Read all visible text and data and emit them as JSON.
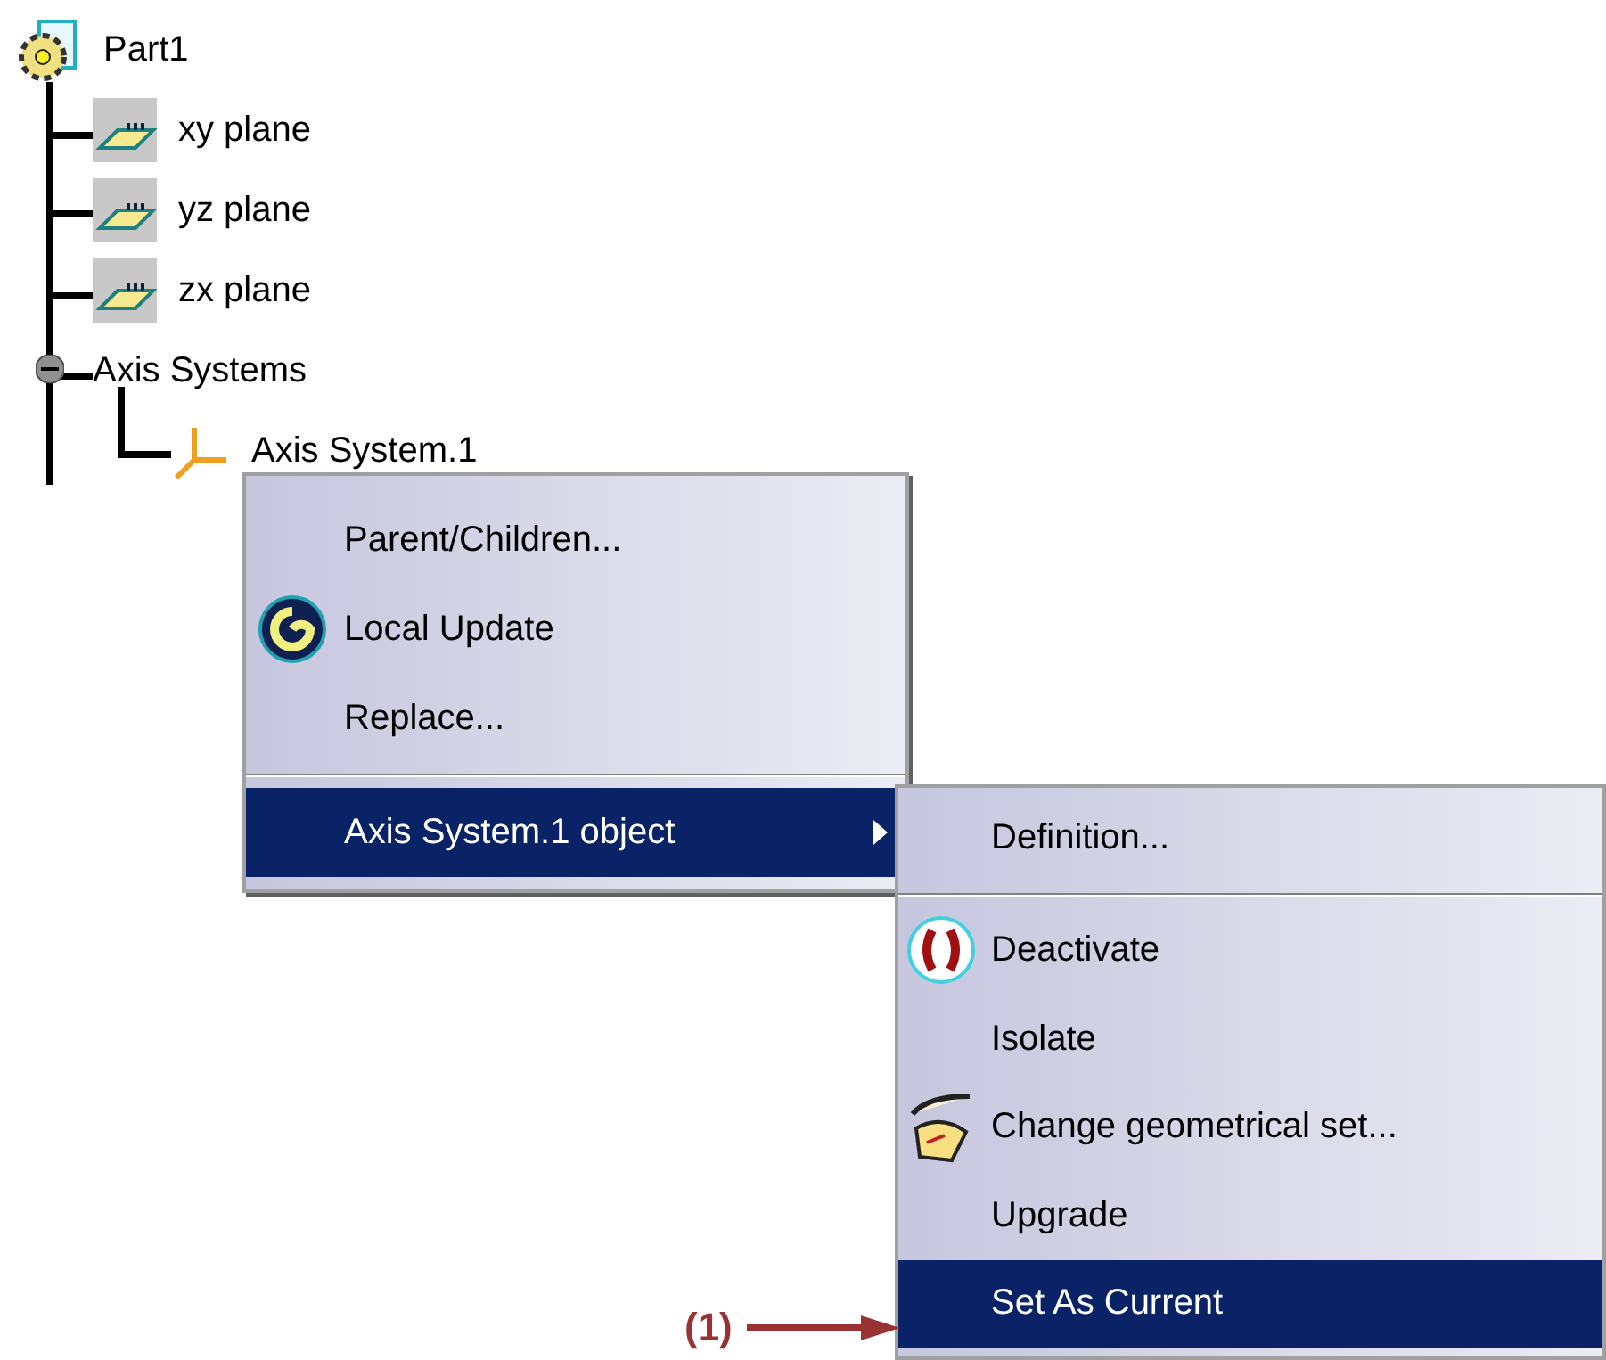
{
  "tree": {
    "label": "Part1",
    "kind": "part",
    "children": [
      {
        "label": "xy plane",
        "kind": "plane"
      },
      {
        "label": "yz plane",
        "kind": "plane"
      },
      {
        "label": "zx plane",
        "kind": "plane"
      },
      {
        "label": "Axis Systems",
        "kind": "group",
        "expanded": true,
        "children": [
          {
            "label": "Axis System.1",
            "kind": "axis"
          }
        ]
      }
    ]
  },
  "context_menu": {
    "items": [
      {
        "kind": "item",
        "label": "Parent/Children...",
        "selected": false,
        "submenu": false
      },
      {
        "kind": "item",
        "label": "Local Update",
        "selected": false,
        "submenu": false
      },
      {
        "kind": "item",
        "label": "Replace...",
        "selected": false,
        "submenu": false
      },
      {
        "kind": "separator"
      },
      {
        "kind": "item",
        "label": "Axis System.1 object",
        "selected": true,
        "submenu": true
      }
    ]
  },
  "submenu": {
    "items": [
      {
        "kind": "item",
        "label": "Definition...",
        "selected": false
      },
      {
        "kind": "separator"
      },
      {
        "kind": "item",
        "label": "Deactivate",
        "selected": false
      },
      {
        "kind": "item",
        "label": "Isolate",
        "selected": false
      },
      {
        "kind": "item",
        "label": "Change geometrical set...",
        "selected": false
      },
      {
        "kind": "item",
        "label": "Upgrade",
        "selected": false
      },
      {
        "kind": "item",
        "label": "Set As Current",
        "selected": true
      }
    ]
  },
  "annotation": {
    "label": "(1)"
  }
}
